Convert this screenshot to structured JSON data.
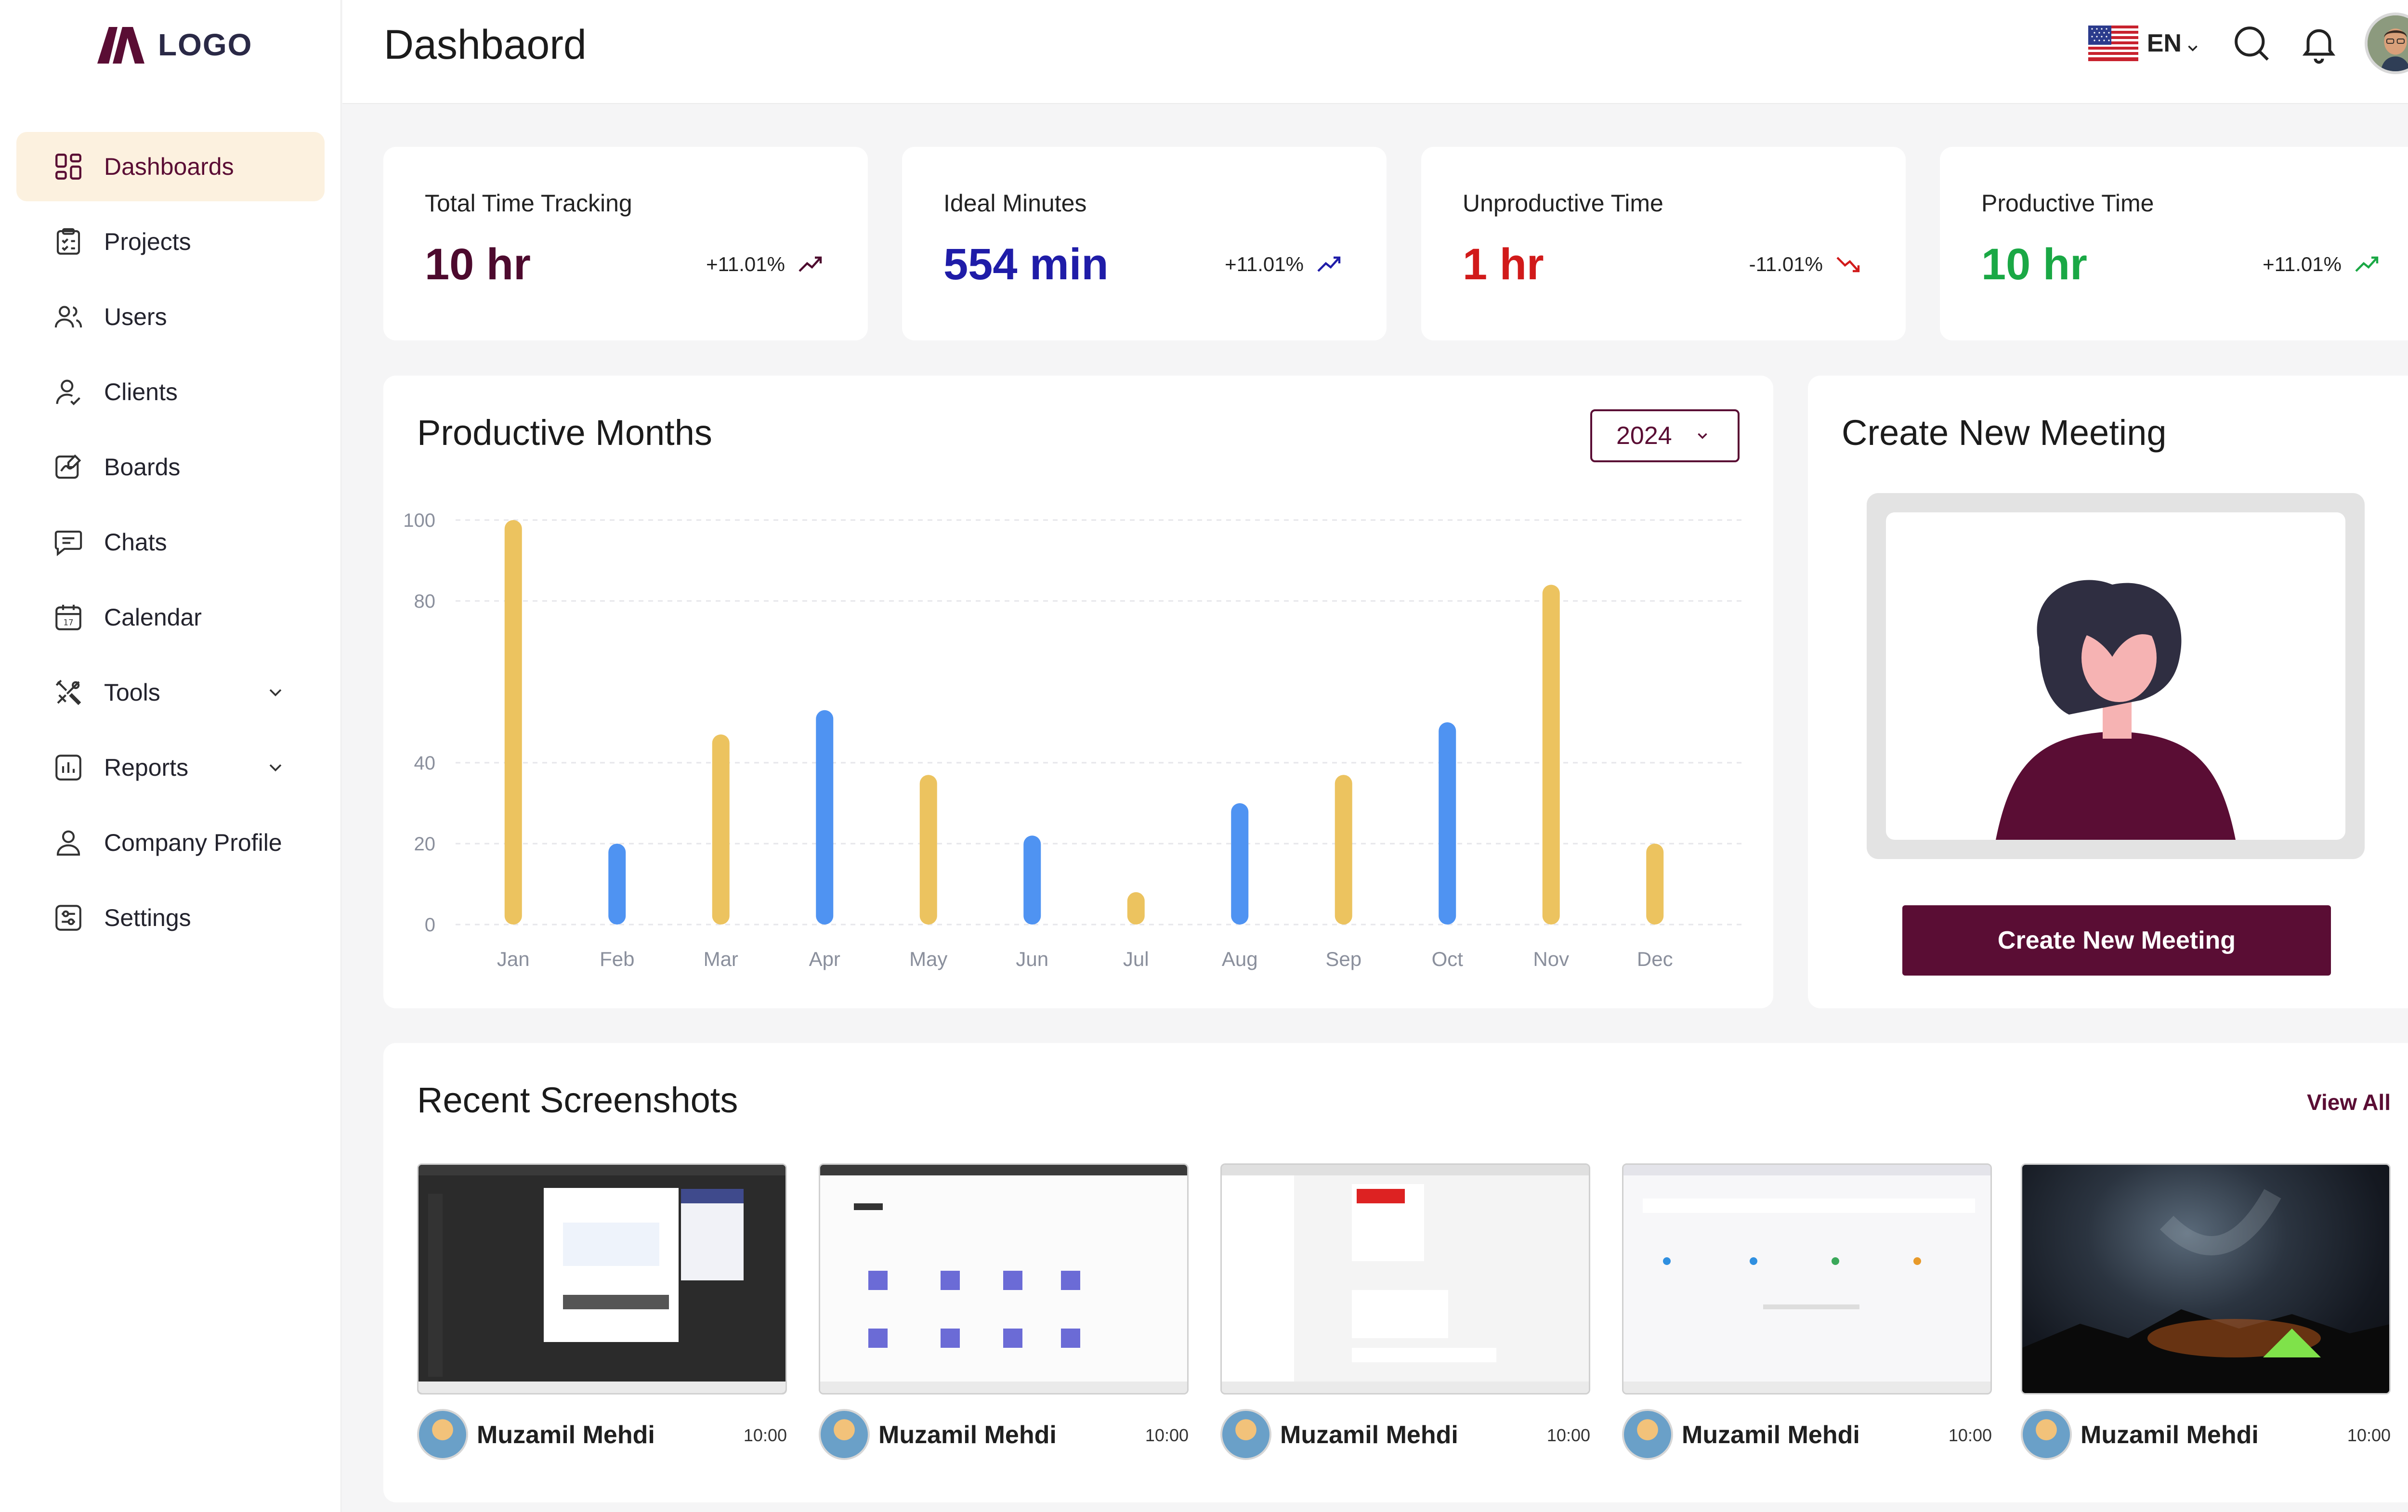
{
  "brand": {
    "logo_text": "LOGO",
    "accent": "#5a0d34"
  },
  "header": {
    "title": "Dashbaord",
    "language": "EN"
  },
  "sidebar": {
    "items": [
      {
        "label": "Dashboards",
        "icon": "dashboard-grid-icon",
        "active": true
      },
      {
        "label": "Projects",
        "icon": "clipboard-icon"
      },
      {
        "label": "Users",
        "icon": "users-icon"
      },
      {
        "label": "Clients",
        "icon": "client-icon"
      },
      {
        "label": "Boards",
        "icon": "board-edit-icon"
      },
      {
        "label": "Chats",
        "icon": "chat-icon"
      },
      {
        "label": "Calendar",
        "icon": "calendar-icon"
      },
      {
        "label": "Tools",
        "icon": "tools-icon",
        "has_submenu": true
      },
      {
        "label": "Reports",
        "icon": "reports-icon",
        "has_submenu": true
      },
      {
        "label": "Company Profile",
        "icon": "profile-icon"
      },
      {
        "label": "Settings",
        "icon": "settings-icon"
      }
    ]
  },
  "stats": [
    {
      "title": "Total Time Tracking",
      "value": "10 hr",
      "change": "+11.01%",
      "trend": "up",
      "color": "#4d0a2e"
    },
    {
      "title": "Ideal Minutes",
      "value": "554 min",
      "change": "+11.01%",
      "trend": "up",
      "color": "#1f1ca8"
    },
    {
      "title": "Unproductive Time",
      "value": "1 hr",
      "change": "-11.01%",
      "trend": "down",
      "color": "#d11a1a"
    },
    {
      "title": "Productive Time",
      "value": "10 hr",
      "change": "+11.01%",
      "trend": "up",
      "color": "#1aa845"
    }
  ],
  "chart": {
    "title": "Productive Months",
    "selected_year": "2024"
  },
  "chart_data": {
    "type": "bar",
    "categories": [
      "Jan",
      "Feb",
      "Mar",
      "Apr",
      "May",
      "Jun",
      "Jul",
      "Aug",
      "Sep",
      "Oct",
      "Nov",
      "Dec"
    ],
    "values": [
      100,
      20,
      47,
      53,
      37,
      22,
      8,
      30,
      37,
      50,
      84,
      20
    ],
    "bar_colors": [
      "#ecc35f",
      "#4f93f2",
      "#ecc35f",
      "#4f93f2",
      "#ecc35f",
      "#4f93f2",
      "#ecc35f",
      "#4f93f2",
      "#ecc35f",
      "#4f93f2",
      "#ecc35f",
      "#ecc35f"
    ],
    "yticks": [
      0,
      20,
      40,
      80,
      100
    ],
    "ylim": [
      0,
      100
    ],
    "grid": true,
    "title": "",
    "xlabel": "",
    "ylabel": ""
  },
  "meeting": {
    "title": "Create New Meeting",
    "button_label": "Create New Meeting"
  },
  "screenshots": {
    "title": "Recent Screenshots",
    "view_all_label": "View All",
    "items": [
      {
        "user": "Muzamil Mehdi",
        "time": "10:00"
      },
      {
        "user": "Muzamil Mehdi",
        "time": "10:00"
      },
      {
        "user": "Muzamil Mehdi",
        "time": "10:00"
      },
      {
        "user": "Muzamil Mehdi",
        "time": "10:00"
      },
      {
        "user": "Muzamil Mehdi",
        "time": "10:00"
      }
    ]
  }
}
